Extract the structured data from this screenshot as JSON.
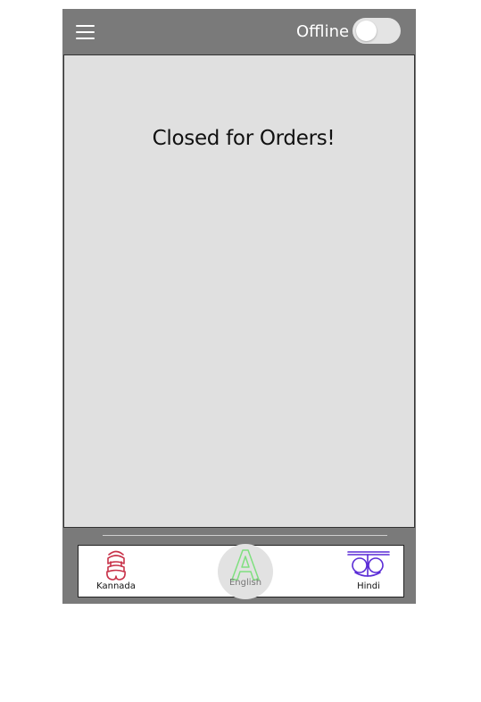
{
  "appbar": {
    "menu_icon": "hamburger-menu-icon",
    "status_label": "Offline",
    "toggle_on": false
  },
  "main": {
    "message": "Closed for Orders!"
  },
  "languages": [
    {
      "label": "Kannada",
      "icon": "kannada-letter-icon",
      "color": "#c8334a",
      "selected": false
    },
    {
      "label": "English",
      "icon": "letter-a-icon",
      "color": "#7fe07f",
      "selected": true
    },
    {
      "label": "Hindi",
      "icon": "hindi-letter-icon",
      "color": "#5a2bd6",
      "selected": false
    }
  ],
  "colors": {
    "appbar": "#7a7a7a",
    "content_bg": "#e0e0e0",
    "toggle_track": "#e4e4e4"
  }
}
